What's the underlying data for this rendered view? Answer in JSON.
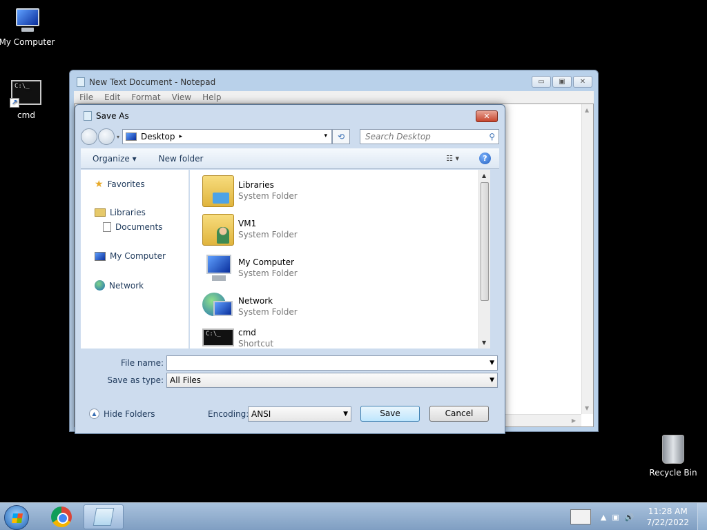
{
  "desktop": {
    "icons": [
      {
        "label": "My Computer",
        "icon": "computer-icon"
      },
      {
        "label": "cmd",
        "icon": "cmd-shortcut-icon"
      },
      {
        "label": "Recycle Bin",
        "icon": "recycle-bin-icon"
      }
    ]
  },
  "notepad": {
    "title": "New Text Document - Notepad",
    "controls": {
      "minimize": "▭",
      "maximize": "▣",
      "close": "✕"
    },
    "menu": [
      "File",
      "Edit",
      "Format",
      "View",
      "Help"
    ]
  },
  "save_dialog": {
    "title": "Save As",
    "close_glyph": "✕",
    "address": {
      "location": "Desktop",
      "chevron": "▸",
      "dropdown": "▾"
    },
    "refresh_glyph": "⟲",
    "search": {
      "placeholder": "Search Desktop",
      "icon_glyph": "⚲"
    },
    "toolbar": {
      "organize": "Organize ▾",
      "new_folder": "New folder",
      "views_glyph": "☷ ▾",
      "help_glyph": "?"
    },
    "nav": {
      "favorites": "Favorites",
      "libraries": "Libraries",
      "documents": "Documents",
      "my_computer": "My Computer",
      "network": "Network"
    },
    "files": [
      {
        "name": "Libraries",
        "type": "System Folder",
        "icon": "libraries-icon"
      },
      {
        "name": "VM1",
        "type": "System Folder",
        "icon": "user-folder-icon"
      },
      {
        "name": "My Computer",
        "type": "System Folder",
        "icon": "computer-icon"
      },
      {
        "name": "Network",
        "type": "System Folder",
        "icon": "network-icon"
      },
      {
        "name": "cmd",
        "type": "Shortcut",
        "icon": "cmd-icon"
      }
    ],
    "cmd_prompt": "C:\\_",
    "file_name": {
      "label": "File name:",
      "value": ""
    },
    "save_as_type": {
      "label": "Save as type:",
      "value": "All Files"
    },
    "encoding": {
      "label": "Encoding:",
      "value": "ANSI"
    },
    "hide_folders": "Hide Folders",
    "save_button": "Save",
    "cancel_button": "Cancel"
  },
  "taskbar": {
    "clock_time": "11:28 AM",
    "clock_date": "7/22/2022",
    "tray_up_glyph": "▲",
    "tray_net_glyph": "▣",
    "tray_vol_glyph": "🔊"
  }
}
